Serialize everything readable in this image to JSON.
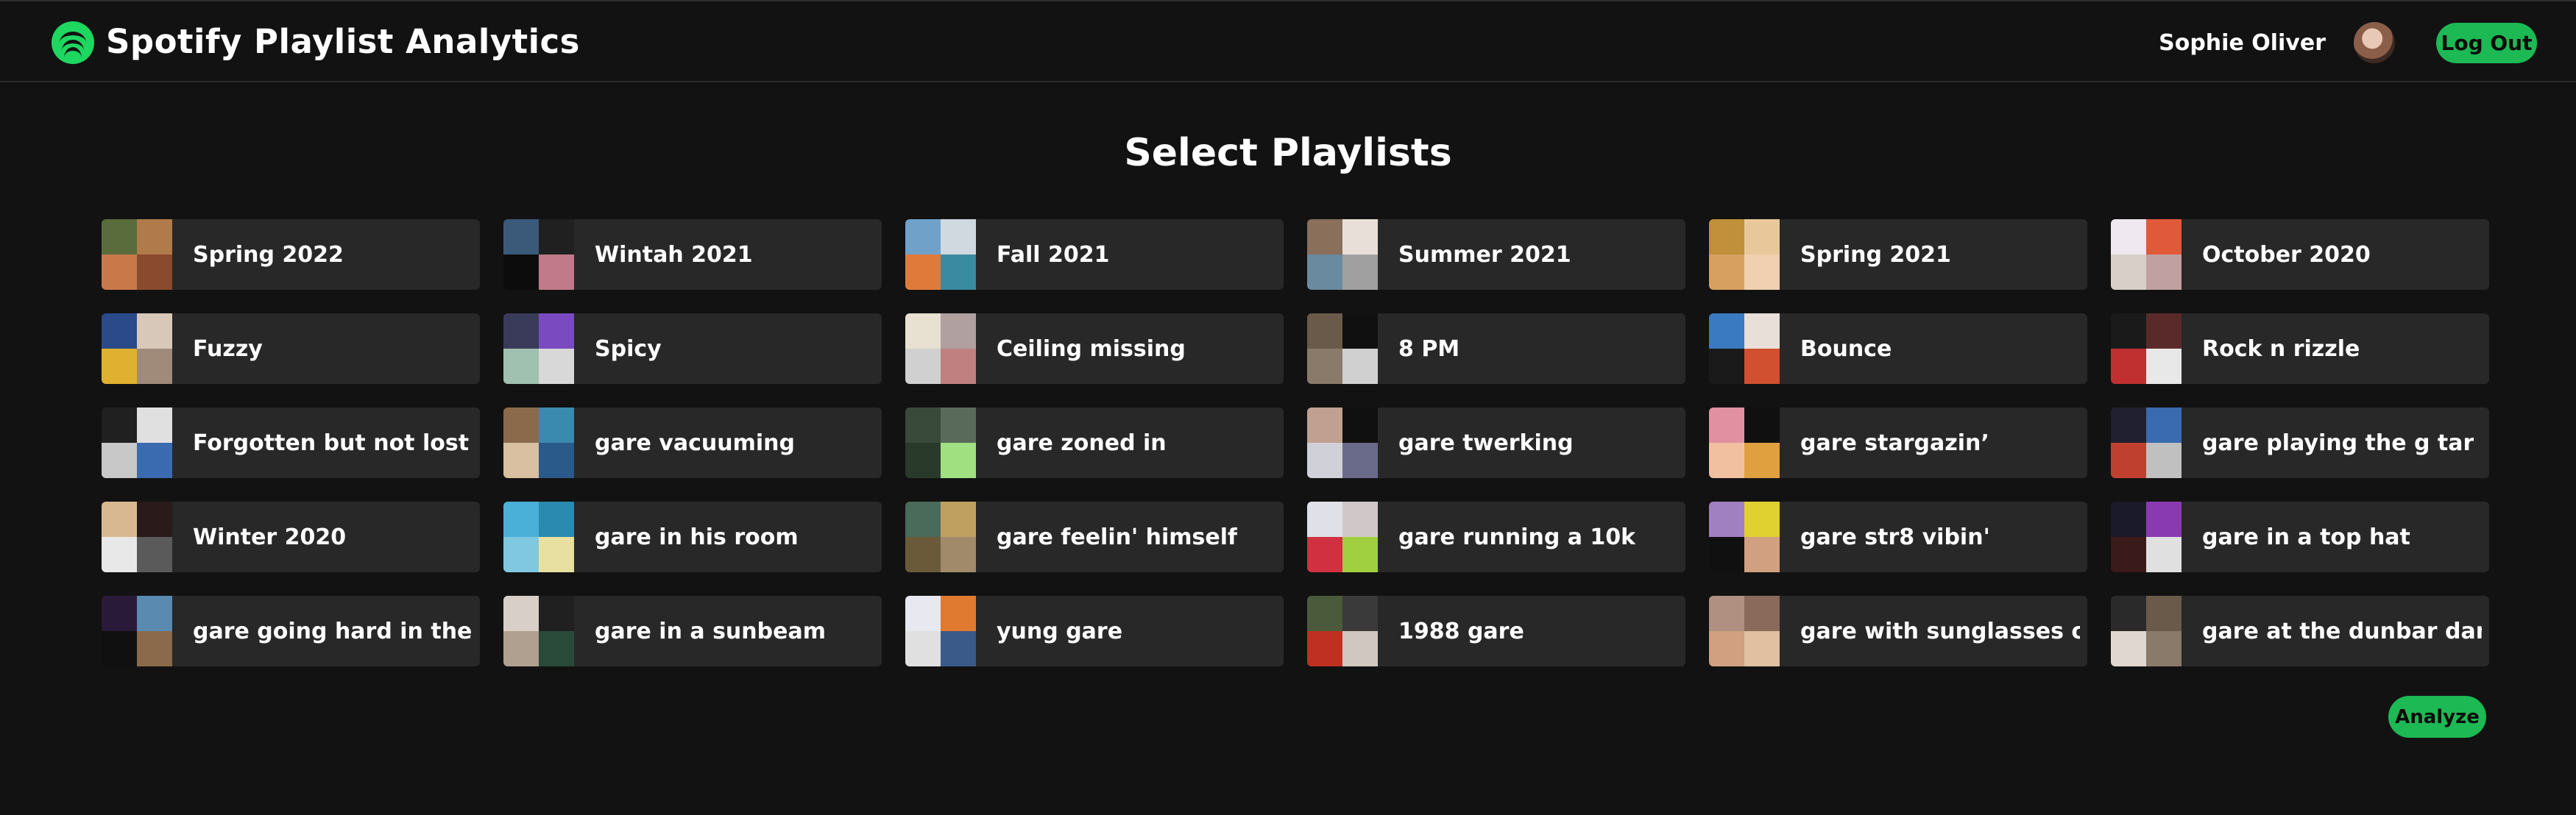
{
  "app": {
    "title": "Spotify Playlist Analytics",
    "logo_icon": "spotify-logo-icon",
    "accent": "#1db954"
  },
  "user": {
    "name": "Sophie Oliver",
    "logout_label": "Log Out"
  },
  "page": {
    "heading": "Select Playlists",
    "analyze_label": "Analyze"
  },
  "playlists": [
    {
      "name": "Spring 2022",
      "cover": [
        "#5a6b3c",
        "#b07a4a",
        "#c9784a",
        "#8a4a2e"
      ]
    },
    {
      "name": "Wintah 2021",
      "cover": [
        "#3b5a7a",
        "#202020",
        "#0c0c0c",
        "#c07a8a"
      ]
    },
    {
      "name": "Fall 2021",
      "cover": [
        "#6fa1c9",
        "#d0d8e0",
        "#e07a3a",
        "#3a8aa0"
      ]
    },
    {
      "name": "Summer 2021",
      "cover": [
        "#8a6f5a",
        "#e8e0d8",
        "#6a8aa0",
        "#a0a0a0"
      ]
    },
    {
      "name": "Spring 2021",
      "cover": [
        "#c0903a",
        "#e8c89a",
        "#d8a060",
        "#f0d0b0"
      ]
    },
    {
      "name": "October 2020",
      "cover": [
        "#f0e8f0",
        "#e05a3a",
        "#d8d0c8",
        "#c0a0a0"
      ]
    },
    {
      "name": "Fuzzy",
      "cover": [
        "#2a4a8a",
        "#d8c8b8",
        "#e0b030",
        "#a08a7a"
      ]
    },
    {
      "name": "Spicy",
      "cover": [
        "#3a3a5a",
        "#7a4ac0",
        "#a0c0b0",
        "#d8d8d8"
      ]
    },
    {
      "name": "Ceiling missing",
      "cover": [
        "#e8e0d0",
        "#b0a0a0",
        "#d0d0d0",
        "#c08080"
      ]
    },
    {
      "name": "8 PM",
      "cover": [
        "#6a5a4a",
        "#101010",
        "#8a7a6a",
        "#d0d0d0"
      ]
    },
    {
      "name": "Bounce",
      "cover": [
        "#3a7ac0",
        "#e8e0d8",
        "#1a1a1a",
        "#d05030"
      ]
    },
    {
      "name": "Rock n rizzle",
      "cover": [
        "#1a1a1a",
        "#5a2a2a",
        "#c03030",
        "#e8e8e8"
      ]
    },
    {
      "name": "Forgotten but not lost ;)",
      "cover": [
        "#202020",
        "#e0e0e0",
        "#c8c8c8",
        "#3a6ab0"
      ]
    },
    {
      "name": "gare vacuuming",
      "cover": [
        "#8a6a4a",
        "#3a8ab0",
        "#d8c0a0",
        "#2a5a8a"
      ]
    },
    {
      "name": "gare zoned in",
      "cover": [
        "#3a4a3a",
        "#5a6a5a",
        "#2a3a2a",
        "#a0e080"
      ]
    },
    {
      "name": "gare twerking",
      "cover": [
        "#c0a090",
        "#101010",
        "#d0d0d8",
        "#6a6a8a"
      ]
    },
    {
      "name": "gare stargazin’",
      "cover": [
        "#e090a0",
        "#101010",
        "#f0c0a0",
        "#e0a040"
      ]
    },
    {
      "name": "gare playing the g tar",
      "cover": [
        "#202030",
        "#3a6ab0",
        "#c04030",
        "#c0c0c0"
      ]
    },
    {
      "name": "Winter 2020",
      "cover": [
        "#d8b890",
        "#2a1a1a",
        "#e8e8e8",
        "#5a5a5a"
      ]
    },
    {
      "name": "gare in his room",
      "cover": [
        "#4ab0d8",
        "#2a8ab0",
        "#80c8e0",
        "#e8e0a0"
      ]
    },
    {
      "name": "gare feelin' himself",
      "cover": [
        "#4a6a5a",
        "#c0a060",
        "#6a5a3a",
        "#a08a6a"
      ]
    },
    {
      "name": "gare running a 10k",
      "cover": [
        "#e0e0e8",
        "#d0c8c8",
        "#d03040",
        "#a0d040"
      ]
    },
    {
      "name": "gare str8 vibin'",
      "cover": [
        "#a080c0",
        "#e0d030",
        "#101010",
        "#d0a080"
      ]
    },
    {
      "name": "gare in a top hat",
      "cover": [
        "#1a1a2a",
        "#8a3ab0",
        "#3a1a1a",
        "#e0e0e0"
      ]
    },
    {
      "name": "gare going hard in the p",
      "cover": [
        "#2a1a3a",
        "#5a8ab0",
        "#101010",
        "#8a6a4a"
      ]
    },
    {
      "name": "gare in a sunbeam",
      "cover": [
        "#d8d0c8",
        "#202020",
        "#b0a090",
        "#2a4a3a"
      ]
    },
    {
      "name": "yung gare",
      "cover": [
        "#e8e8f0",
        "#e07a30",
        "#e0e0e0",
        "#3a5a8a"
      ]
    },
    {
      "name": "1988 gare",
      "cover": [
        "#4a5a3a",
        "#3a3a3a",
        "#c03020",
        "#d0c8c0"
      ]
    },
    {
      "name": "gare with sunglasses on",
      "cover": [
        "#b09080",
        "#8a6a5a",
        "#d0a080",
        "#e0c0a0"
      ]
    },
    {
      "name": "gare at the dunbar dance",
      "cover": [
        "#2a2a2a",
        "#6a5a4a",
        "#e0d8d0",
        "#8a7a6a"
      ]
    }
  ]
}
